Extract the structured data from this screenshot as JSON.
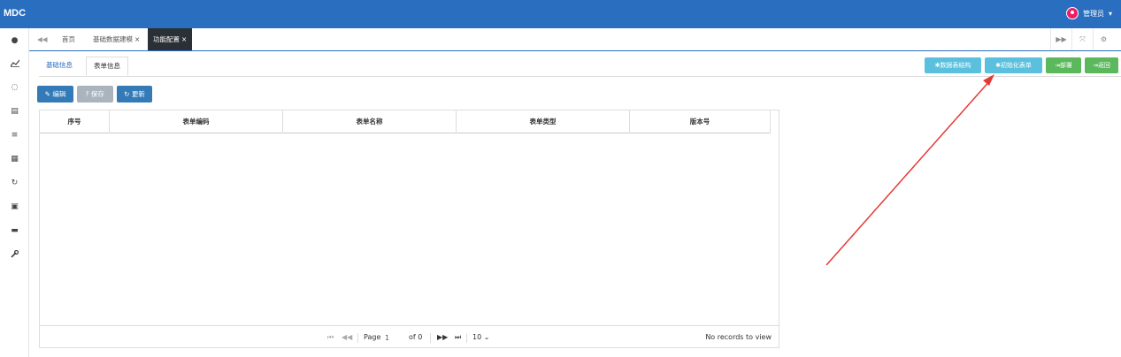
{
  "app": {
    "brand": "MDC",
    "user_name": "管理员"
  },
  "sidebar": {
    "icons": [
      "●",
      "📈",
      "◌",
      "▤",
      "≡",
      "▦",
      "↻",
      "▣",
      "▬",
      "⚲"
    ]
  },
  "tabs": [
    {
      "label": "首页"
    },
    {
      "label": "基础数据建模",
      "close": "×"
    },
    {
      "label": "功能配置",
      "close": "×"
    }
  ],
  "subtabs": [
    {
      "label": "基础信息"
    },
    {
      "label": "表单信息"
    }
  ],
  "actions": {
    "data_structure": "数据表结构",
    "init_form": "初始化表单",
    "deploy": "部署",
    "back": "返回"
  },
  "toolbar": {
    "edit": "编辑",
    "save": "保存",
    "refresh": "更新"
  },
  "table": {
    "columns": [
      "序号",
      "表单编码",
      "表单名称",
      "表单类型",
      "版本号"
    ],
    "rows": []
  },
  "pager": {
    "page_label": "Page",
    "page_value": "1",
    "of_label": "of 0",
    "page_size": "10",
    "status": "No records to view"
  },
  "colors": {
    "header": "#2a6fbf",
    "info": "#5bc0de",
    "success": "#5cb85c",
    "annotation": "#e53935"
  }
}
